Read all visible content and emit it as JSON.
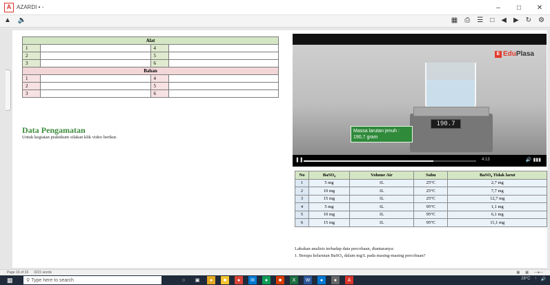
{
  "window": {
    "title": "AZARDI",
    "title_suffix": "• -",
    "minimize": "–",
    "maximize": "□",
    "close": "✕"
  },
  "toolbar": {
    "left_icons": [
      "person-icon",
      "speaker-icon"
    ],
    "right_icons": [
      "grid-icon",
      "print-icon",
      "list-icon",
      "page-icon",
      "prev-icon",
      "next-icon",
      "refresh-icon",
      "settings-icon"
    ]
  },
  "alat_table": {
    "header": "Alat",
    "rows": [
      [
        "1",
        "4"
      ],
      [
        "2",
        "5"
      ],
      [
        "3",
        "6"
      ]
    ]
  },
  "bahan_table": {
    "header": "Bahan",
    "rows": [
      [
        "1",
        "4"
      ],
      [
        "2",
        "5"
      ],
      [
        "3",
        "6"
      ]
    ]
  },
  "section": {
    "title": "Data Pengamatan",
    "desc": "Untuk kegiatan praktikum silakan klik video berikut."
  },
  "video": {
    "brand_a": "Edu",
    "brand_b": "Plasa",
    "callout_line1": "Massa larutan jenuh :",
    "callout_line2": "190,7 gram",
    "display": "190.7",
    "time": "4:13",
    "progress": 0.75
  },
  "data_table": {
    "headers": [
      "No",
      "BaSO₄",
      "Volume Air",
      "Suhu",
      "BaSO₄ Tidak larut"
    ],
    "rows": [
      [
        "1",
        "5 mg",
        "1L",
        "25°C",
        "2,7 mg"
      ],
      [
        "2",
        "10 mg",
        "1L",
        "25°C",
        "7,7 mg"
      ],
      [
        "3",
        "15 mg",
        "1L",
        "25°C",
        "12,7 mg"
      ],
      [
        "4",
        "5 mg",
        "1L",
        "95°C",
        "1,1 mg"
      ],
      [
        "5",
        "10 mg",
        "1L",
        "95°C",
        "6,1 mg"
      ],
      [
        "6",
        "15 mg",
        "1L",
        "95°C",
        "11,1 mg"
      ]
    ]
  },
  "analysis": {
    "line1": "Lakukan analisis terhadap data percobaan, diantaranya:",
    "line2": "1.   Berapa kelarutan BaSO₄ dalam mg/L pada masing-masing percobaan?"
  },
  "statusbar": {
    "page": "Page 16 of 33",
    "words": "3221 words"
  },
  "taskbar": {
    "search_placeholder": "Type here to search",
    "weather": "28°C"
  }
}
